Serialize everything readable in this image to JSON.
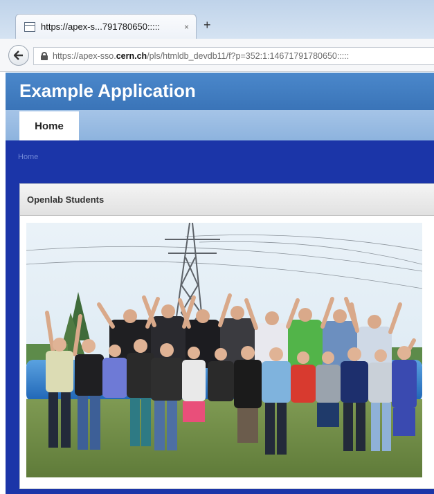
{
  "browser": {
    "tab": {
      "title": "https://apex-s...791780650:::::",
      "close": "×"
    },
    "new_tab": "+",
    "address": {
      "prefix": "https://apex-sso.",
      "domain": "cern.ch",
      "suffix": "/pls/htmldb_devdb11/f?p=352:1:14671791780650:::::"
    }
  },
  "app": {
    "title": "Example Application",
    "tabs": [
      {
        "label": "Home",
        "active": true
      }
    ],
    "breadcrumb": "Home",
    "region": {
      "title": "Openlab Students"
    },
    "image": {
      "subject": "group photo of students with raised arms on a lawn in front of an electricity pylon"
    }
  },
  "colors": {
    "header": "#3f7cc0",
    "tabbar": "#98bbe2",
    "body": "#1b35a8"
  }
}
